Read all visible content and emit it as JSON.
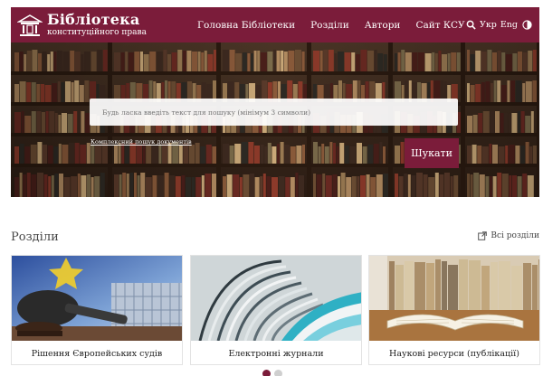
{
  "header": {
    "title": "Бібліотека",
    "subtitle": "конституційного права",
    "nav": [
      "Головна Бібліотеки",
      "Розділи",
      "Автори",
      "Сайт КСУ"
    ],
    "lang_ukr": "Укр",
    "lang_eng": "Eng"
  },
  "hero": {
    "search_placeholder": "Будь ласка введіть текст для пошуку (мінімум 3 символи)",
    "advanced_link": "Комплексний пошук документів",
    "search_button": "Шукати"
  },
  "sections": {
    "title": "Розділи",
    "all_link": "Всі розділи",
    "cards": [
      {
        "label": "Рішення Європейських судів"
      },
      {
        "label": "Електронні журнали"
      },
      {
        "label": "Наукові ресурси (публікації)"
      }
    ]
  },
  "colors": {
    "brand": "#7b1c3a"
  }
}
